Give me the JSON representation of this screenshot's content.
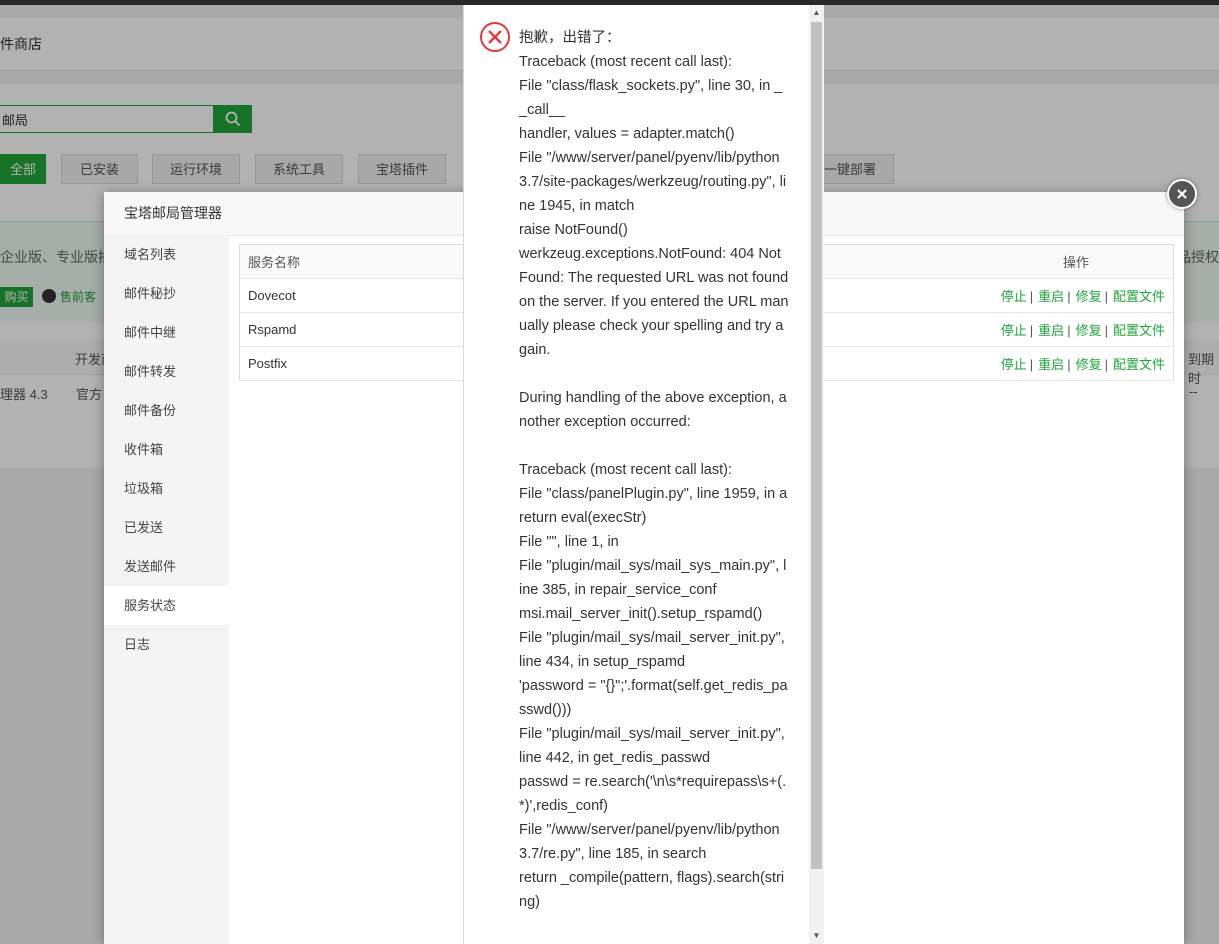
{
  "store": {
    "title": "件商店",
    "search_value": "邮局",
    "categories": [
      "全部",
      "已安装",
      "运行环境",
      "系统工具",
      "宝塔插件",
      "一键部署"
    ],
    "promo_text": "企业版、专业版插",
    "promo_right": "品授权",
    "buy_label": "购买",
    "qq_label": "售前客",
    "col_dev": "开发商",
    "col_expiry": "到期时",
    "row_name": "理器 4.3",
    "row_dev": "官方",
    "row_expiry": "--"
  },
  "modal": {
    "title": "宝塔邮局管理器",
    "menu": [
      "域名列表",
      "邮件秘抄",
      "邮件中继",
      "邮件转发",
      "邮件备份",
      "收件箱",
      "垃圾箱",
      "已发送",
      "发送邮件",
      "服务状态",
      "日志"
    ],
    "active_menu": "服务状态",
    "table": {
      "col_name": "服务名称",
      "col_ops": "操作",
      "rows": [
        {
          "name": "Dovecot"
        },
        {
          "name": "Rspamd"
        },
        {
          "name": "Postfix"
        }
      ],
      "ops": [
        "停止",
        "重启",
        "修复",
        "配置文件"
      ]
    }
  },
  "error": {
    "message": "抱歉，出错了：\nTraceback (most recent call last):\nFile \"class/flask_sockets.py\", line 30, in __call__\nhandler, values = adapter.match()\nFile \"/www/server/panel/pyenv/lib/python3.7/site-packages/werkzeug/routing.py\", line 1945, in match\nraise NotFound()\nwerkzeug.exceptions.NotFound: 404 Not Found: The requested URL was not found on the server. If you entered the URL manually please check your spelling and try again.\n\nDuring handling of the above exception, another exception occurred:\n\nTraceback (most recent call last):\nFile \"class/panelPlugin.py\", line 1959, in a\nreturn eval(execStr)\nFile \"\", line 1, in\nFile \"plugin/mail_sys/mail_sys_main.py\", line 385, in repair_service_conf\nmsi.mail_server_init().setup_rspamd()\nFile \"plugin/mail_sys/mail_server_init.py\", line 434, in setup_rspamd\n'password = \"{}\";'.format(self.get_redis_passwd()))\nFile \"plugin/mail_sys/mail_server_init.py\", line 442, in get_redis_passwd\npasswd = re.search('\\n\\s*requirepass\\s+(.*)',redis_conf)\nFile \"/www/server/panel/pyenv/lib/python3.7/re.py\", line 185, in search\nreturn _compile(pattern, flags).search(string)"
  },
  "colors": {
    "accent": "#20a53a",
    "error_red": "#e5393b"
  }
}
